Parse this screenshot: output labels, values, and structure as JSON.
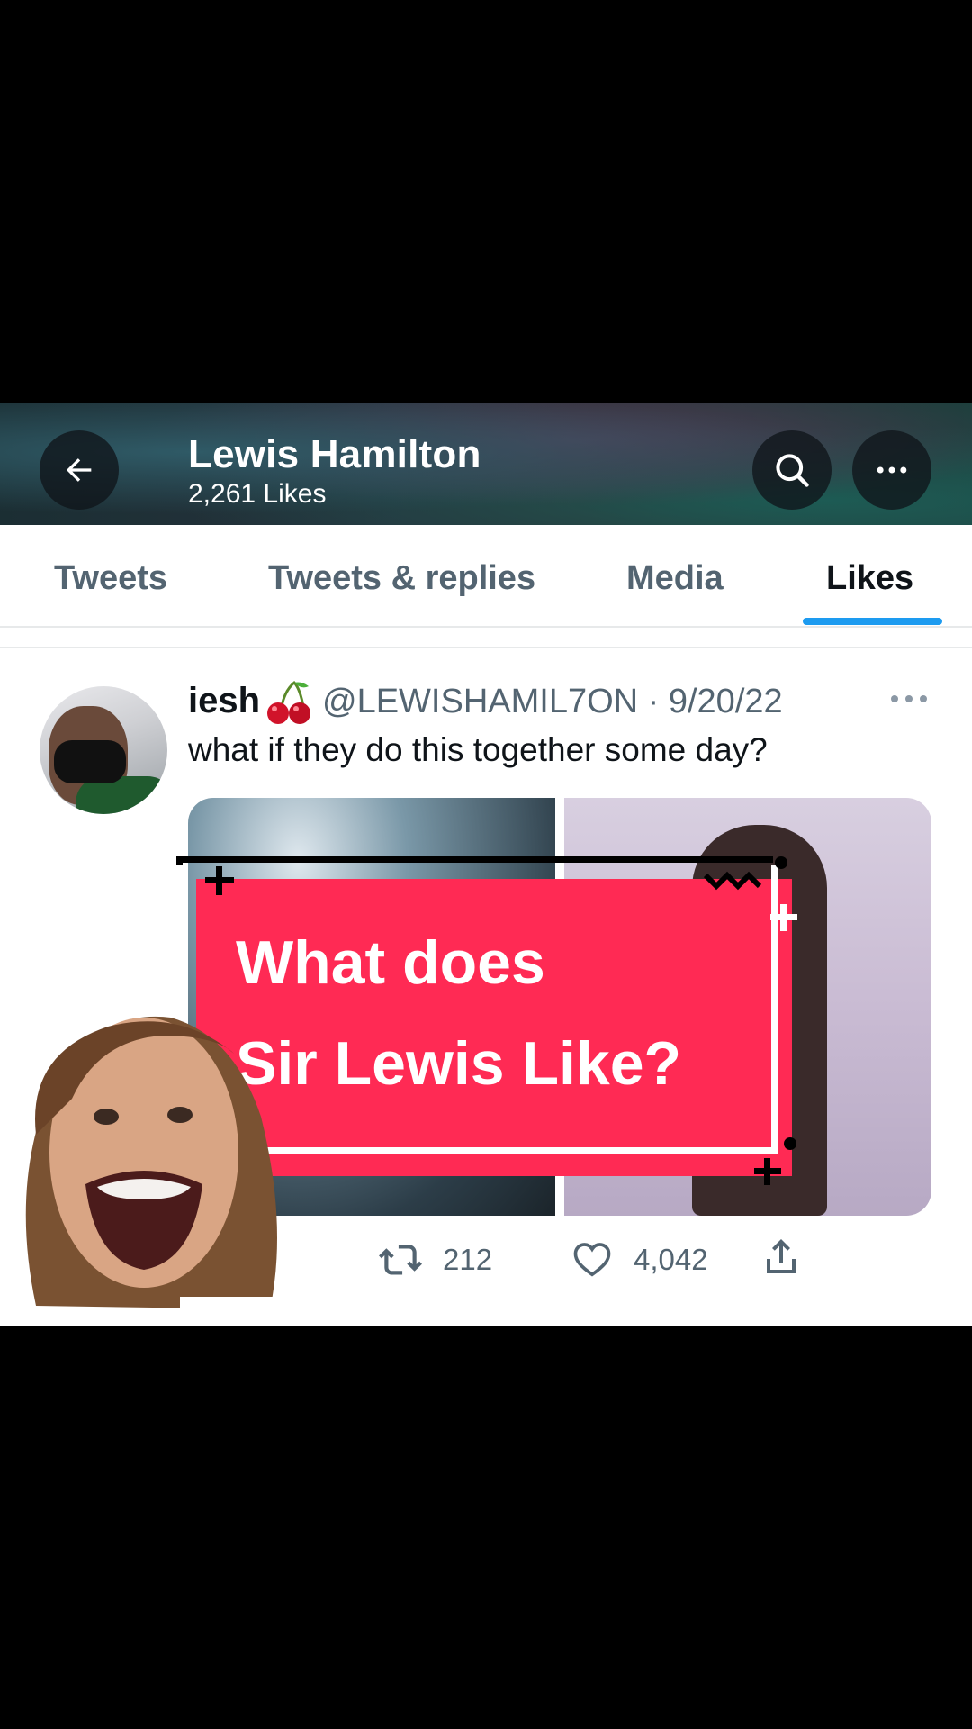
{
  "header": {
    "title": "Lewis Hamilton",
    "subtitle": "2,261 Likes",
    "back_icon": "arrow-left-icon",
    "search_icon": "search-icon",
    "more_icon": "more-horizontal-icon"
  },
  "tabs": [
    {
      "label": "Tweets"
    },
    {
      "label": "Tweets & replies"
    },
    {
      "label": "Media"
    },
    {
      "label": "Likes",
      "active": true
    }
  ],
  "tweet": {
    "name": "iesh",
    "name_emoji": "cherries",
    "handle_date": "@LEWISHAMIL7ON · 9/20/22",
    "text": "what if they do this together some day?",
    "retweets": "212",
    "likes": "4,042"
  },
  "overlay": {
    "line1": "What does",
    "line2": "Sir Lewis Like?"
  },
  "colors": {
    "accent": "#1d9bf0",
    "sticker": "#ff2a54",
    "text_primary": "#0f1419",
    "text_secondary": "#536471"
  }
}
